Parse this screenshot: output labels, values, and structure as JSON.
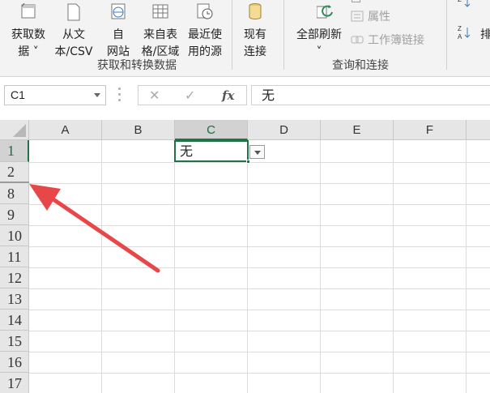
{
  "ribbon": {
    "group_get_transform": {
      "label": "获取和转换数据",
      "buttons": [
        {
          "line1": "获取数",
          "line2": "据 ˅",
          "icon": "get-data-icon"
        },
        {
          "line1": "从文",
          "line2": "本/CSV",
          "icon": "from-text-icon"
        },
        {
          "line1": "自",
          "line2": "网站",
          "icon": "web-icon"
        },
        {
          "line1": "来自表",
          "line2": "格/区域",
          "icon": "table-icon"
        },
        {
          "line1": "最近使",
          "line2": "用的源",
          "icon": "recent-sources-icon"
        },
        {
          "line1": "现有",
          "line2": "连接",
          "icon": "existing-connections-icon"
        }
      ]
    },
    "group_queries": {
      "label": "查询和连接",
      "refresh_all": {
        "line1": "全部刷新",
        "line2": "˅",
        "icon": "refresh-icon"
      },
      "properties": "属性",
      "workbook_links": "工作簿链接"
    },
    "sort": {
      "az_icon": "sort-az-icon",
      "za_icon": "sort-za-icon",
      "partial": "排"
    }
  },
  "formula_bar": {
    "name_box": "C1",
    "cancel": "✕",
    "enter": "✓",
    "fx": "fx",
    "content": "无"
  },
  "grid": {
    "columns": [
      "A",
      "B",
      "C",
      "D",
      "E",
      "F"
    ],
    "selected_column": "C",
    "rows": [
      "1",
      "2",
      "8",
      "9",
      "10",
      "11",
      "12",
      "13",
      "14",
      "15",
      "16",
      "17"
    ],
    "selected_row": "1",
    "active_cell": {
      "ref": "C1",
      "value": "无",
      "has_dropdown": true
    }
  },
  "colors": {
    "accent_green": "#217346",
    "annotation_red": "#e8474a"
  },
  "annotation": {
    "icon": "red-arrow-icon"
  }
}
